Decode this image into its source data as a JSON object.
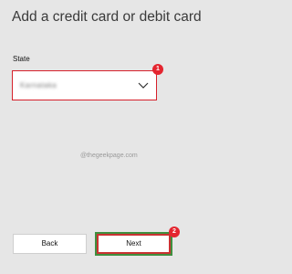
{
  "header": {
    "title": "Add a credit card or debit card"
  },
  "form": {
    "state_label": "State",
    "state_value": "Karnataka"
  },
  "annotations": {
    "step1": "1",
    "step2": "2",
    "watermark": "@thegeekpage.com"
  },
  "footer": {
    "back_label": "Back",
    "next_label": "Next"
  },
  "colors": {
    "highlight": "#d6202a",
    "badge": "#e4252f",
    "next_outline": "#3f8f3f"
  },
  "icons": {
    "dropdown": "chevron-down-icon"
  }
}
